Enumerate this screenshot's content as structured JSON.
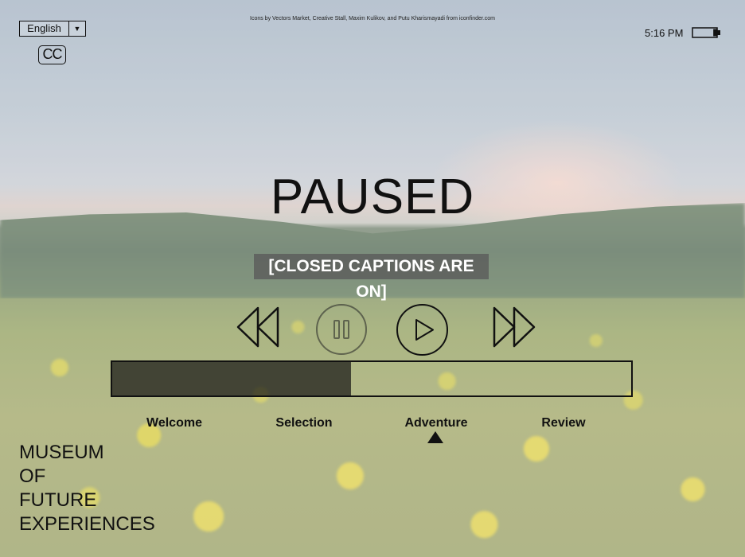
{
  "credit": "Icons by Vectors Market, Creative Stall, Maxim Kulikov, and Putu Kharismayadi from iconfinder.com",
  "language": {
    "selected": "English"
  },
  "captions_toggle": {
    "label": "CC"
  },
  "clock": {
    "time": "5:16 PM"
  },
  "battery": {
    "level": 0.15
  },
  "status": {
    "title": "PAUSED",
    "caption": "[CLOSED CAPTIONS ARE ON]"
  },
  "controls": {
    "rewind_icon": "rewind-icon",
    "pause_icon": "pause-icon",
    "play_icon": "play-icon",
    "forward_icon": "fast-forward-icon"
  },
  "progress": {
    "fraction": 0.46
  },
  "chapters": [
    "Welcome",
    "Selection",
    "Adventure",
    "Review"
  ],
  "current_chapter": "Adventure",
  "brand": {
    "lines": [
      "MUSEUM",
      "OF",
      "FUTURE",
      "EXPERIENCES"
    ]
  }
}
